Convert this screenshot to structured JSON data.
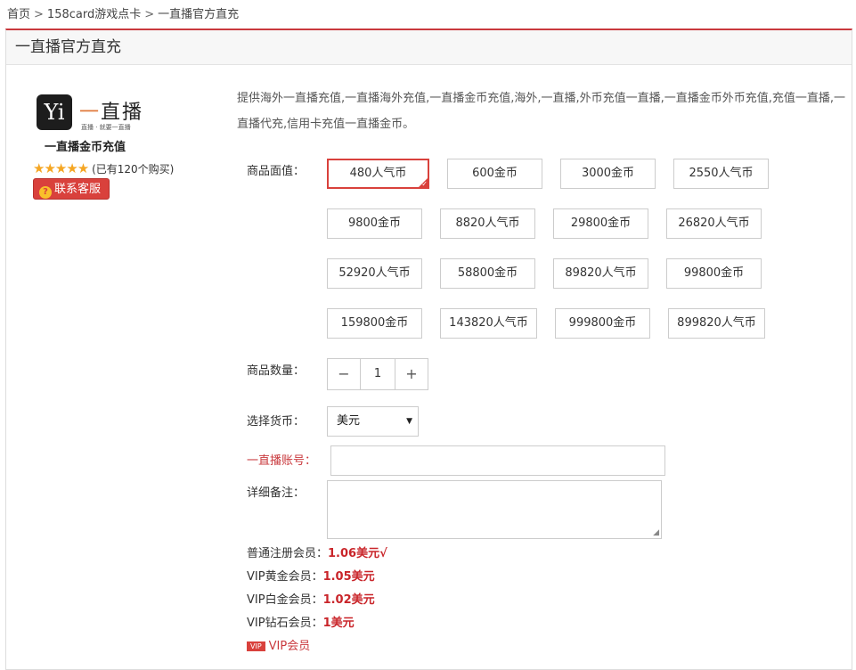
{
  "breadcrumb": {
    "home": "首页",
    "sep1": ">",
    "category": "158card游戏点卡",
    "sep2": ">",
    "current": "一直播官方直充"
  },
  "panel": {
    "title": "一直播官方直充"
  },
  "product": {
    "logo_letter": "Yi",
    "logo_text_accent": "一",
    "logo_text_main": "直播",
    "logo_sub": "直播 · 就要一直播",
    "name": "一直播金币充值",
    "stars": "★★★★★",
    "purchase_count": "(已有120个购买)",
    "contact_icon": "?",
    "contact_label": "联系客服"
  },
  "description": "提供海外一直播充值,一直播海外充值,一直播金币充值,海外,一直播,外币充值一直播,一直播金币外币充值,充值一直播,一直播代充,信用卡充值一直播金币。",
  "form": {
    "denomination_label": "商品面值：",
    "denominations": [
      "480人气币",
      "600金币",
      "3000金币",
      "2550人气币",
      "9800金币",
      "8820人气币",
      "29800金币",
      "26820人气币",
      "52920人气币",
      "58800金币",
      "89820人气币",
      "99800金币",
      "159800金币",
      "143820人气币",
      "999800金币",
      "899820人气币"
    ],
    "selected_check": "✓",
    "quantity_label": "商品数量：",
    "quantity_minus": "−",
    "quantity_value": "1",
    "quantity_plus": "+",
    "currency_label": "选择货币：",
    "currency_value": "美元",
    "currency_arrow": "▼",
    "account_label": "一直播账号：",
    "remark_label": "详细备注：",
    "textarea_grip": "◢"
  },
  "pricing": {
    "regular_label": "普通注册会员：",
    "regular_value": "1.06美元√",
    "gold_label": "VIP黄金会员：",
    "gold_value": "1.05美元",
    "platinum_label": "VIP白金会员：",
    "platinum_value": "1.02美元",
    "diamond_label": "VIP钻石会员：",
    "diamond_value": "1美元",
    "vip_badge": "VIP",
    "vip_link": "VIP会员"
  },
  "colors": {
    "accent": "#d9413c",
    "price": "#c9252a",
    "star": "#f5a623"
  }
}
